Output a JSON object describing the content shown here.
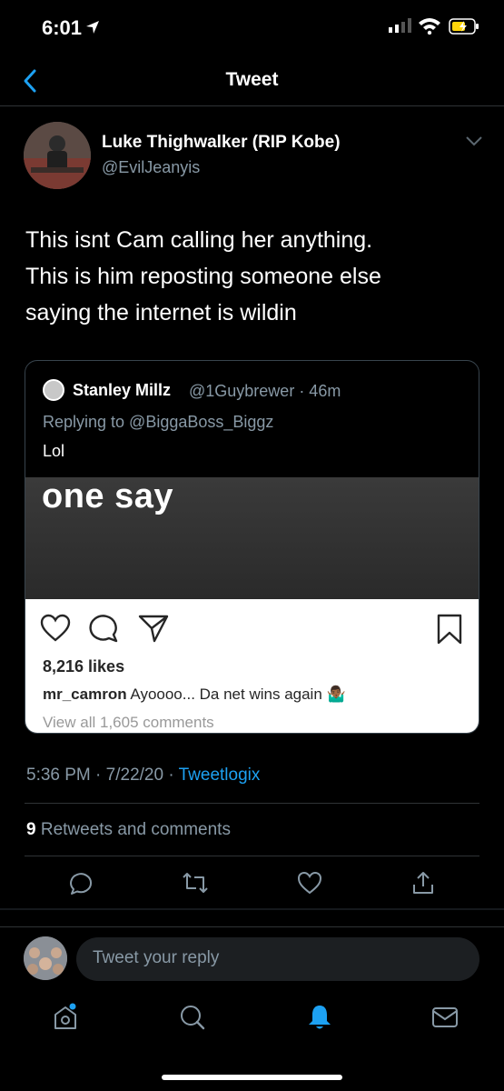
{
  "status_bar": {
    "time": "6:01"
  },
  "header": {
    "title": "Tweet"
  },
  "tweet": {
    "author_name": "Luke Thighwalker (RIP Kobe)",
    "author_handle": "@EvilJeanyis",
    "text_lines": [
      "This isnt Cam calling her anything.",
      "This is him reposting someone else",
      "saying the internet is wildin"
    ],
    "time": "5:36 PM",
    "date": "7/22/20",
    "separator": "·",
    "source": "Tweetlogix",
    "retweet_count": "9",
    "retweet_label": "Retweets and comments"
  },
  "quote": {
    "name": "Stanley Millz",
    "handle_time": "@1Guybrewer · 46m",
    "reply_to": "Replying to @BiggaBoss_Biggz",
    "text": "Lol",
    "media_text": "one say",
    "ig_likes": "8,216 likes",
    "ig_user": "mr_camron",
    "ig_caption": "Ayoooo... Da net wins again 🤷🏾‍♂️",
    "ig_view_all": "View all 1,605 comments"
  },
  "reply_bar": {
    "placeholder": "Tweet your reply"
  },
  "colors": {
    "accent": "#1da1f2",
    "muted": "#8899a6",
    "divider": "#2f3336"
  }
}
